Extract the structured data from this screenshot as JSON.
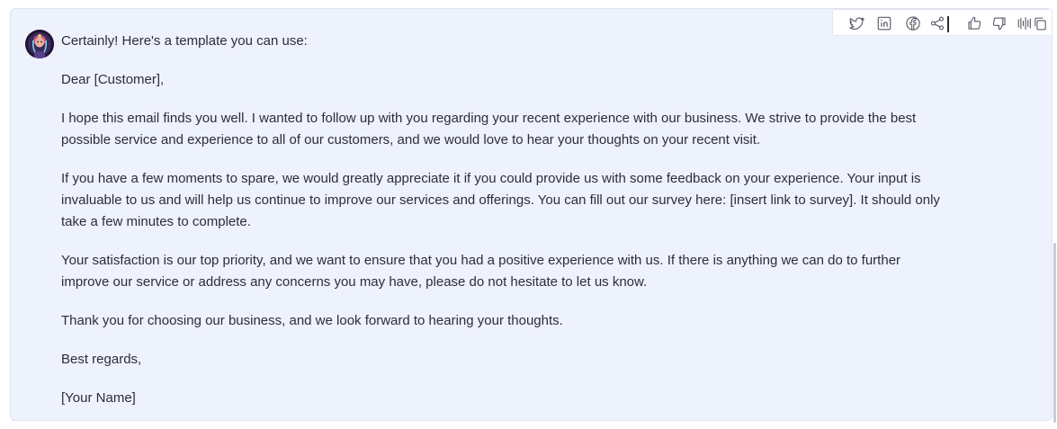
{
  "message": {
    "paragraphs": [
      "Certainly! Here's a template you can use:",
      "Dear [Customer],",
      "I hope this email finds you well. I wanted to follow up with you regarding your recent experience with our business. We strive to provide the best possible service and experience to all of our customers, and we would love to hear your thoughts on your recent visit.",
      "If you have a few moments to spare, we would greatly appreciate it if you could provide us with some feedback on your experience. Your input is invaluable to us and will help us continue to improve our services and offerings. You can fill out our survey here: [insert link to survey]. It should only take a few minutes to complete.",
      "Your satisfaction is our top priority, and we want to ensure that you had a positive experience with us. If there is anything we can do to further improve our service or address any concerns you may have, please do not hesitate to let us know.",
      "Thank you for choosing our business, and we look forward to hearing your thoughts.",
      "Best regards,",
      "[Your Name]"
    ]
  },
  "toolbar": {
    "icons": [
      "twitter-icon",
      "linkedin-icon",
      "facebook-icon",
      "share-icon",
      "thumbs-up-icon",
      "thumbs-down-icon",
      "audio-waveform-icon",
      "copy-icon"
    ]
  },
  "colors": {
    "card_background": "#eef2fd",
    "text": "#2b2e3a",
    "icon": "#555a66"
  }
}
